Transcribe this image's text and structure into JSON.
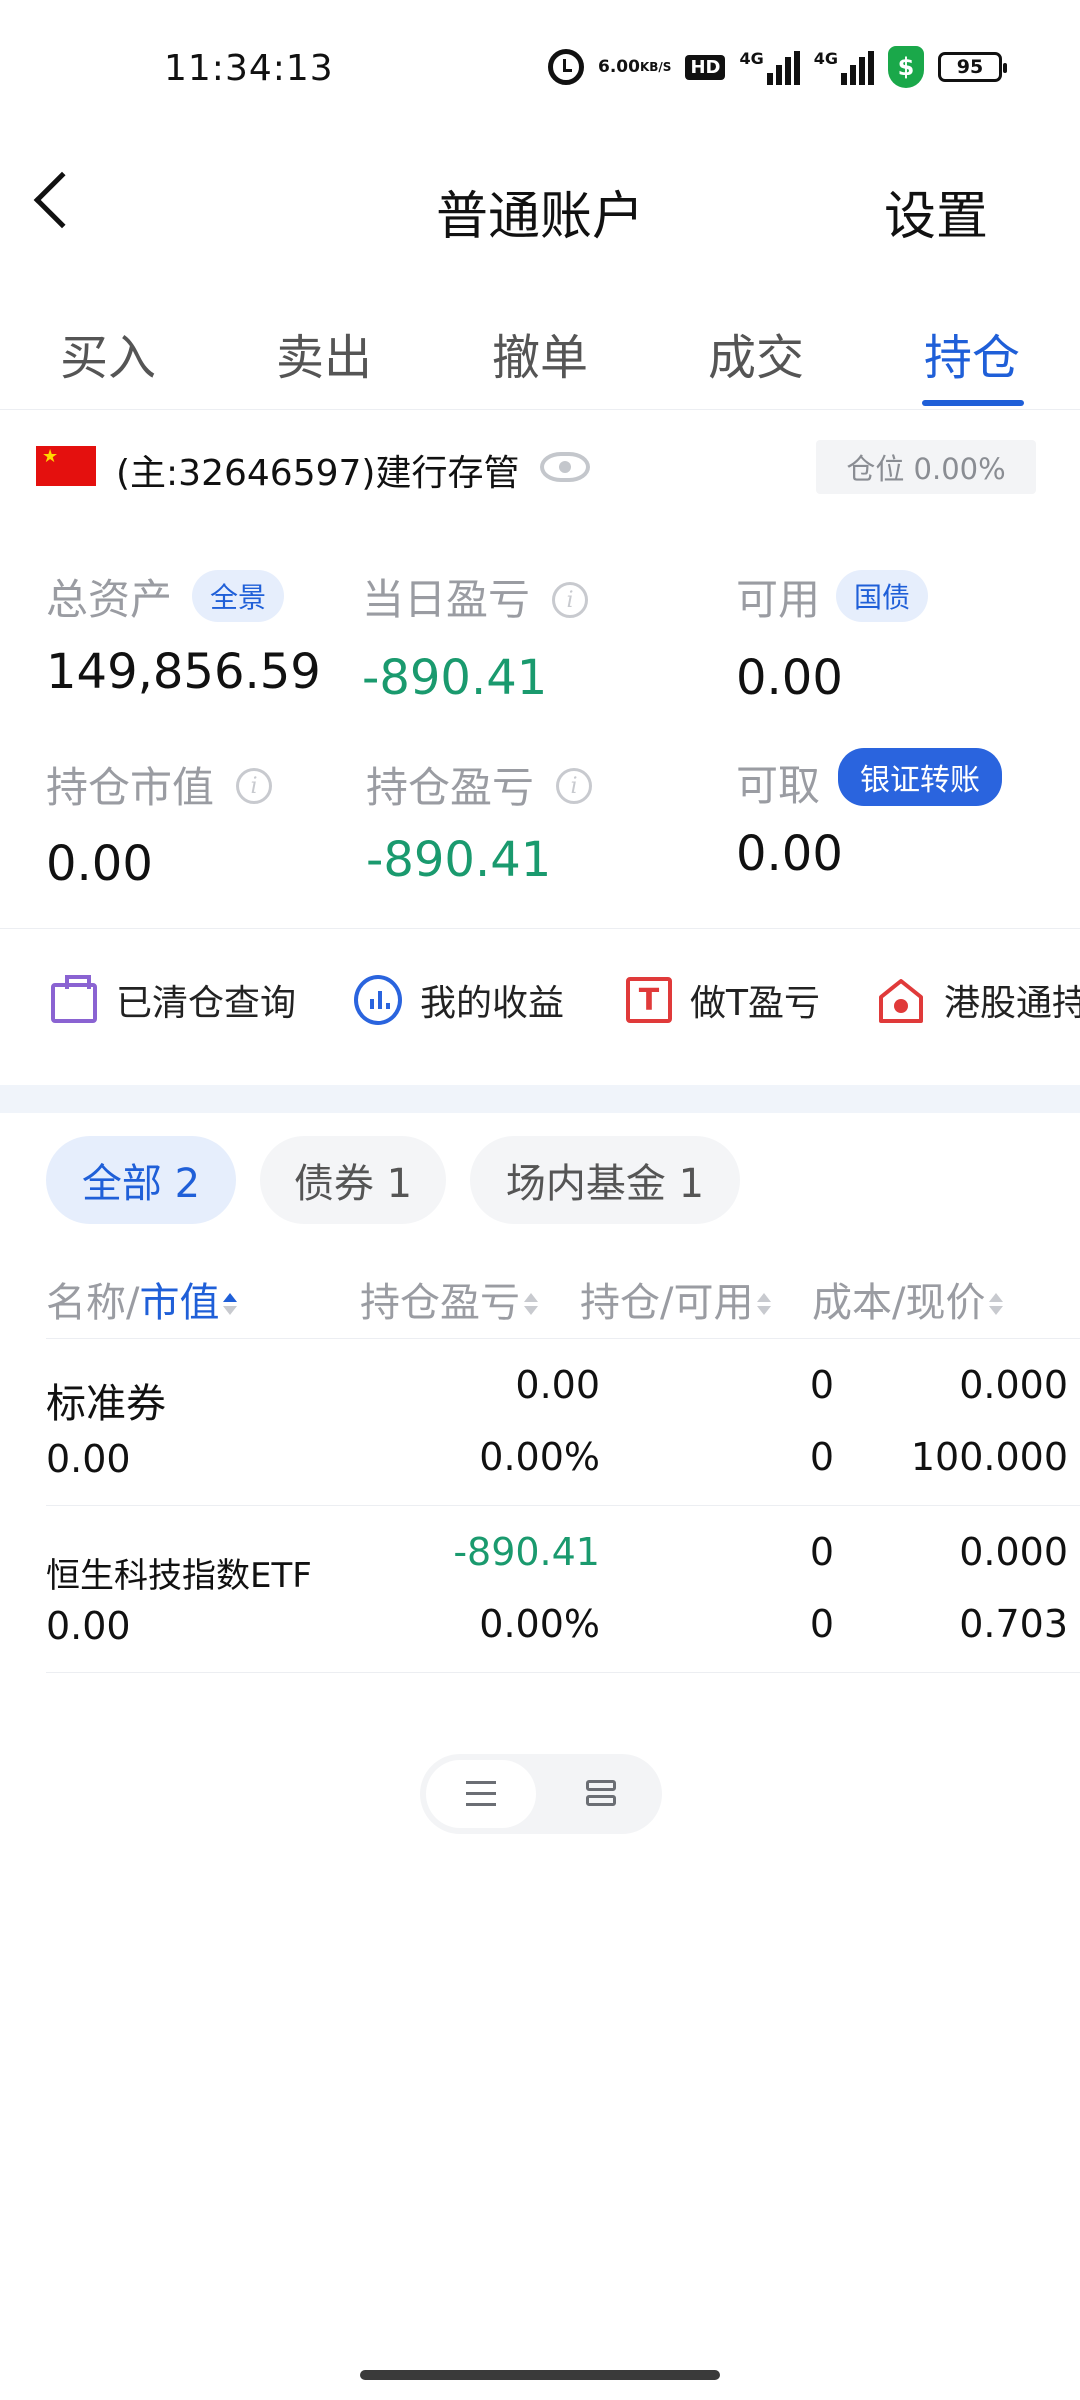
{
  "status_bar": {
    "time": "11:34:13",
    "net_speed_value": "6.00",
    "net_speed_unit": "KB/S",
    "hd_label": "HD",
    "sim1": "4G",
    "sim2": "4G",
    "battery": "95"
  },
  "header": {
    "title": "普通账户",
    "settings": "设置"
  },
  "tabs": [
    {
      "label": "买入"
    },
    {
      "label": "卖出"
    },
    {
      "label": "撤单"
    },
    {
      "label": "成交"
    },
    {
      "label": "持仓"
    }
  ],
  "active_tab": "持仓",
  "account": {
    "text": "(主:32646597)建行存管",
    "position_ratio": "仓位 0.00%"
  },
  "stats": {
    "total_assets_label": "总资产",
    "total_assets_tag": "全景",
    "total_assets_value": "149,856.59",
    "daily_pnl_label": "当日盈亏",
    "daily_pnl_value": "-890.41",
    "available_label": "可用",
    "available_tag": "国债",
    "available_value": "0.00",
    "holding_value_label": "持仓市值",
    "holding_value": "0.00",
    "holding_pnl_label": "持仓盈亏",
    "holding_pnl_value": "-890.41",
    "withdrawable_label": "可取",
    "withdrawable_tag": "银证转账",
    "withdrawable_value": "0.00"
  },
  "shortcuts": [
    {
      "label": "已清仓查询",
      "icon": "briefcase-icon"
    },
    {
      "label": "我的收益",
      "icon": "chart-search-icon"
    },
    {
      "label": "做T盈亏",
      "icon": "t-box-icon"
    },
    {
      "label": "港股通持",
      "icon": "hk-house-icon"
    }
  ],
  "filters": [
    {
      "label": "全部 2"
    },
    {
      "label": "债券 1"
    },
    {
      "label": "场内基金 1"
    }
  ],
  "table": {
    "headers": {
      "name": "名称/",
      "market_value": "市值",
      "pnl": "持仓盈亏",
      "holding": "持仓/可用",
      "cost": "成本/现价"
    },
    "rows": [
      {
        "name": "标准券",
        "market_value": "0.00",
        "pnl": "0.00",
        "pnl_pct": "0.00%",
        "holding": "0",
        "available": "0",
        "cost": "0.000",
        "price": "100.000"
      },
      {
        "name": "恒生科技指数ETF",
        "market_value": "0.00",
        "pnl": "-890.41",
        "pnl_pct": "0.00%",
        "holding": "0",
        "available": "0",
        "cost": "0.000",
        "price": "0.703"
      }
    ]
  },
  "colors": {
    "accent": "#1f5fd8",
    "loss_green": "#1a9a6e"
  }
}
